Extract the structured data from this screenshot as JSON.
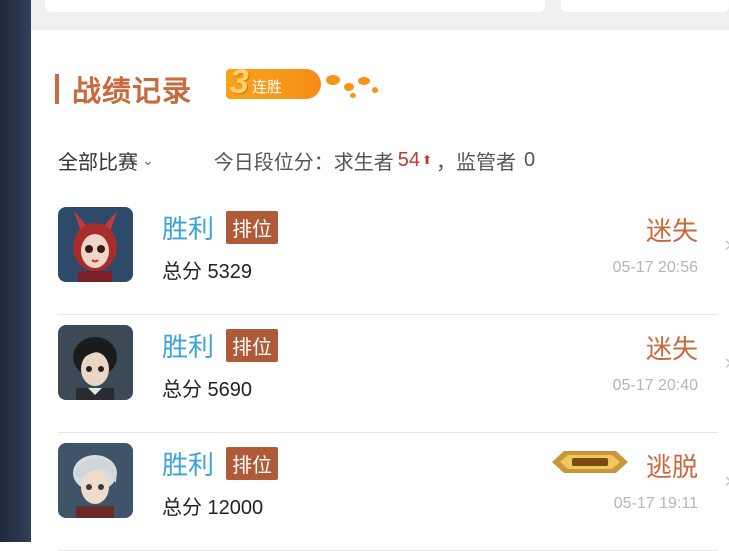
{
  "section": {
    "title": "战绩记录",
    "streak_count": "3",
    "streak_label": "连胜"
  },
  "filter": {
    "selected": "全部比赛",
    "summary_prefix": "今日段位分：求生者",
    "survivor_score": "54",
    "summary_mid": "，监管者",
    "hunter_score": "0"
  },
  "matches": [
    {
      "result": "胜利",
      "mode": "排位",
      "total": "总分 5329",
      "outcome": "迷失",
      "time": "05-17 20:56"
    },
    {
      "result": "胜利",
      "mode": "排位",
      "total": "总分 5690",
      "outcome": "迷失",
      "time": "05-17 20:40"
    },
    {
      "result": "胜利",
      "mode": "排位",
      "total": "总分 12000",
      "outcome": "逃脱",
      "time": "05-17 19:11"
    }
  ],
  "colors": {
    "accent": "#c86a3e",
    "win": "#3aa3d8",
    "badge": "#b05b38",
    "score_up": "#c0392b"
  }
}
